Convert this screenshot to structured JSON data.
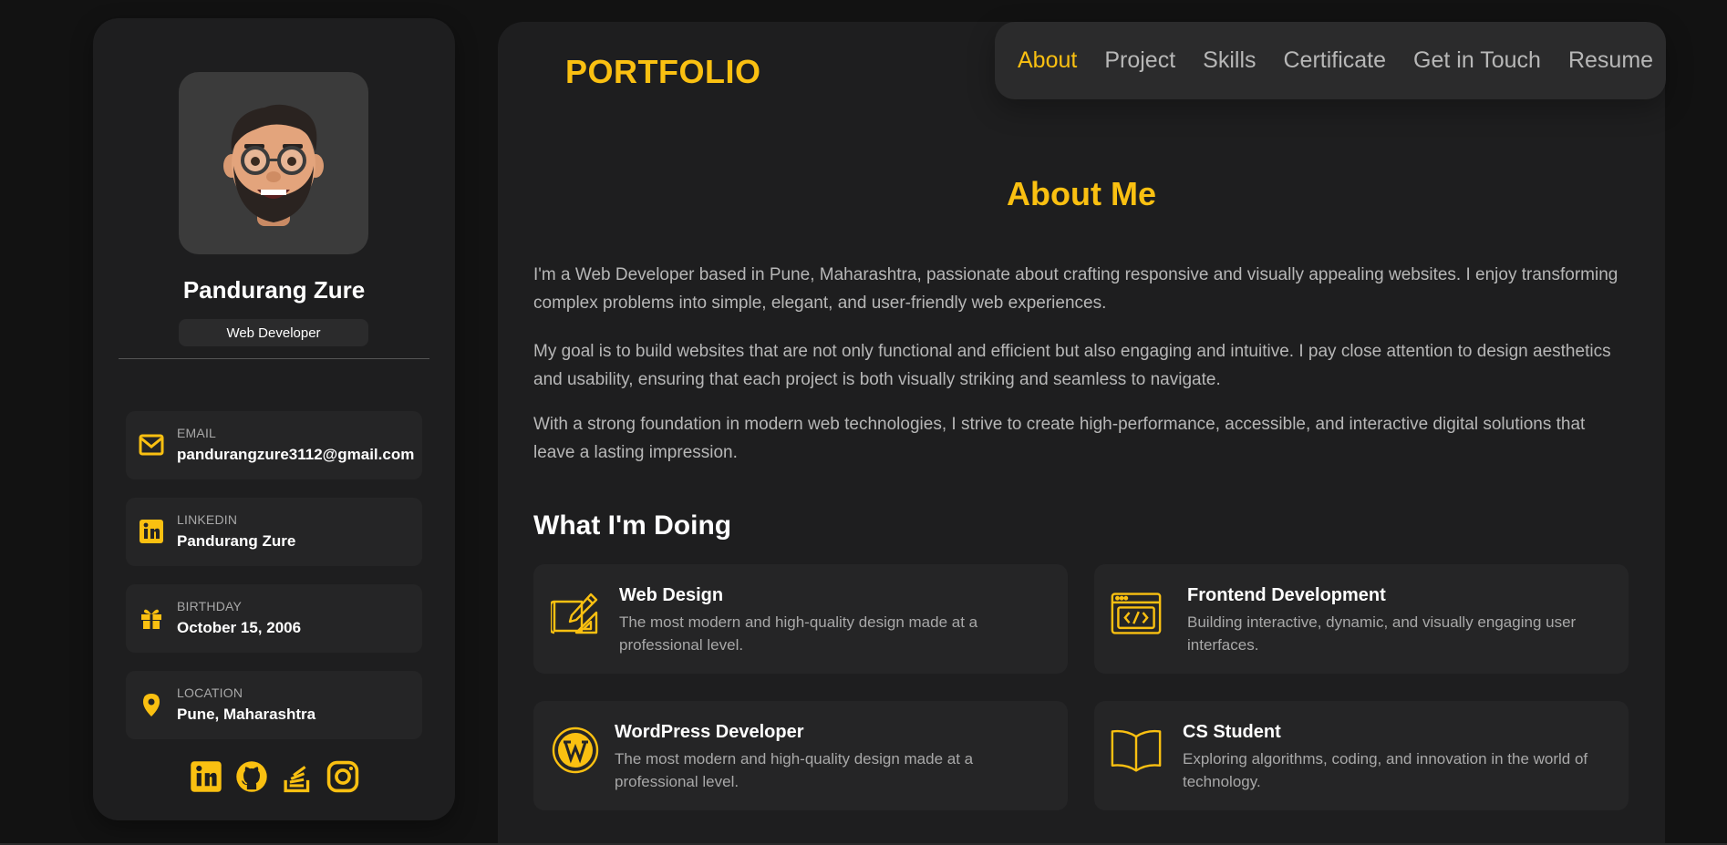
{
  "profile": {
    "name": "Pandurang Zure",
    "role": "Web Developer"
  },
  "contacts": [
    {
      "label": "EMAIL",
      "value": "pandurangzure3112@gmail.com",
      "icon": "mail-icon"
    },
    {
      "label": "LINKEDIN",
      "value": "Pandurang Zure",
      "icon": "linkedin-icon"
    },
    {
      "label": "BIRTHDAY",
      "value": "October 15, 2006",
      "icon": "gift-icon"
    },
    {
      "label": "LOCATION",
      "value": "Pune, Maharashtra",
      "icon": "location-pin-icon"
    }
  ],
  "socials": [
    "linkedin-icon",
    "github-icon",
    "stackoverflow-icon",
    "instagram-icon"
  ],
  "header": {
    "logo": "PORTFOLIO",
    "nav": [
      "About",
      "Project",
      "Skills",
      "Certificate",
      "Get in Touch",
      "Resume"
    ],
    "active": "About"
  },
  "about": {
    "title": "About Me",
    "paragraphs": [
      "I'm a Web Developer based in Pune, Maharashtra, passionate about crafting responsive and visually appealing websites. I enjoy transforming complex problems into simple, elegant, and user-friendly web experiences.",
      "My goal is to build websites that are not only functional and efficient but also engaging and intuitive. I pay close attention to design aesthetics and usability, ensuring that each project is both visually striking and seamless to navigate.",
      "With a strong foundation in modern web technologies, I strive to create high-performance, accessible, and interactive digital solutions that leave a lasting impression."
    ]
  },
  "doing": {
    "title": "What I'm Doing",
    "cards": [
      {
        "title": "Web Design",
        "text": "The most modern and high-quality design made at a professional level.",
        "icon": "design-tools-icon"
      },
      {
        "title": "Frontend Development",
        "text": "Building interactive, dynamic, and visually engaging user interfaces.",
        "icon": "code-window-icon"
      },
      {
        "title": "WordPress Developer",
        "text": "The most modern and high-quality design made at a professional level.",
        "icon": "wordpress-icon"
      },
      {
        "title": "CS Student",
        "text": "Exploring algorithms, coding, and innovation in the world of technology.",
        "icon": "open-book-icon"
      }
    ]
  },
  "colors": {
    "accent": "#fac011",
    "background": "#121212",
    "panel": "#1e1e1f",
    "card": "#252526",
    "nav": "#2b2b2c"
  }
}
